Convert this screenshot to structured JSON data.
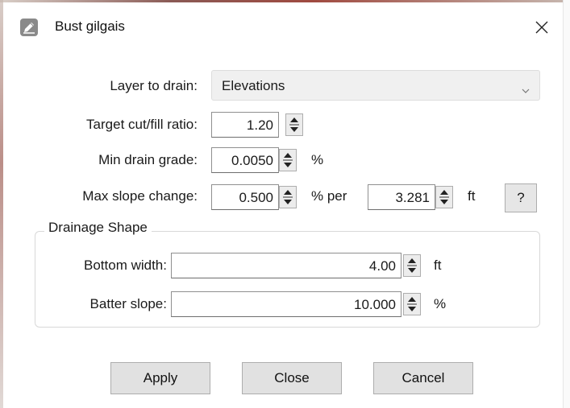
{
  "window": {
    "title": "Bust gilgais",
    "app_icon": "edit-pencil-icon",
    "close_icon": "close-icon"
  },
  "form": {
    "layer_label": "Layer to drain:",
    "layer_value": "Elevations",
    "ratio_label": "Target cut/fill ratio:",
    "ratio_value": "1.20",
    "min_grade_label": "Min drain grade:",
    "min_grade_value": "0.0050",
    "min_grade_unit": "%",
    "max_slope_label": "Max slope change:",
    "max_slope_value": "0.500",
    "max_slope_unit": "% per",
    "distance_value": "3.281",
    "distance_unit": "ft",
    "help_label": "?"
  },
  "drainage_shape": {
    "title": "Drainage Shape",
    "bottom_width_label": "Bottom width:",
    "bottom_width_value": "4.00",
    "bottom_width_unit": "ft",
    "batter_slope_label": "Batter slope:",
    "batter_slope_value": "10.000",
    "batter_slope_unit": "%"
  },
  "buttons": {
    "apply": "Apply",
    "close": "Close",
    "cancel": "Cancel"
  },
  "colors": {
    "button_bg": "#e1e1e1",
    "button_border": "#adadad",
    "field_border": "#8f8f8f",
    "select_bg": "#f0f0f0"
  }
}
